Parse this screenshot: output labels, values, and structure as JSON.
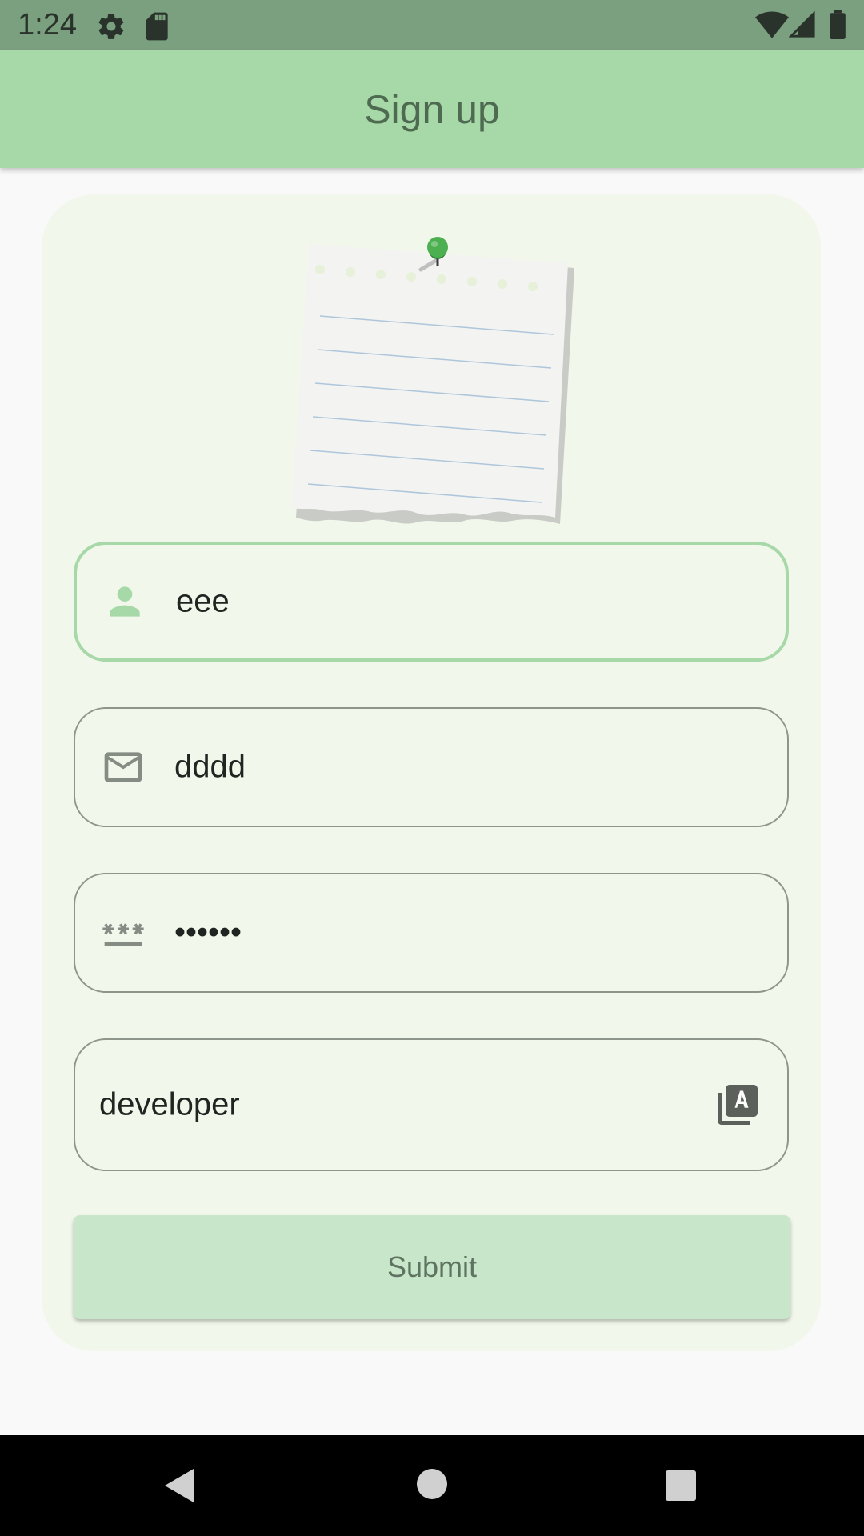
{
  "status_bar": {
    "time": "1:24",
    "icons": [
      "gear-icon",
      "sd-card-icon",
      "wifi-icon",
      "signal-icon",
      "battery-icon"
    ],
    "background": "#7ba07f"
  },
  "app_bar": {
    "title": "Sign up",
    "background": "#a6d8a8"
  },
  "form": {
    "illustration": "pinned-note-icon",
    "fields": [
      {
        "name": "username",
        "icon": "person-icon",
        "value": "eee",
        "focused": true
      },
      {
        "name": "email",
        "icon": "mail-icon",
        "value": "dddd",
        "focused": false
      },
      {
        "name": "password",
        "icon": "password-icon",
        "value": "••••••",
        "focused": false
      },
      {
        "name": "role",
        "trailing_icon": "font-download-icon",
        "value": "developer",
        "focused": false
      }
    ],
    "submit_label": "Submit"
  },
  "nav_bar": {
    "buttons": [
      "back-icon",
      "home-icon",
      "recents-icon"
    ]
  },
  "colors": {
    "accent": "#a6d8a8",
    "card": "#f1f7ea",
    "submit": "#c8e6c9"
  }
}
